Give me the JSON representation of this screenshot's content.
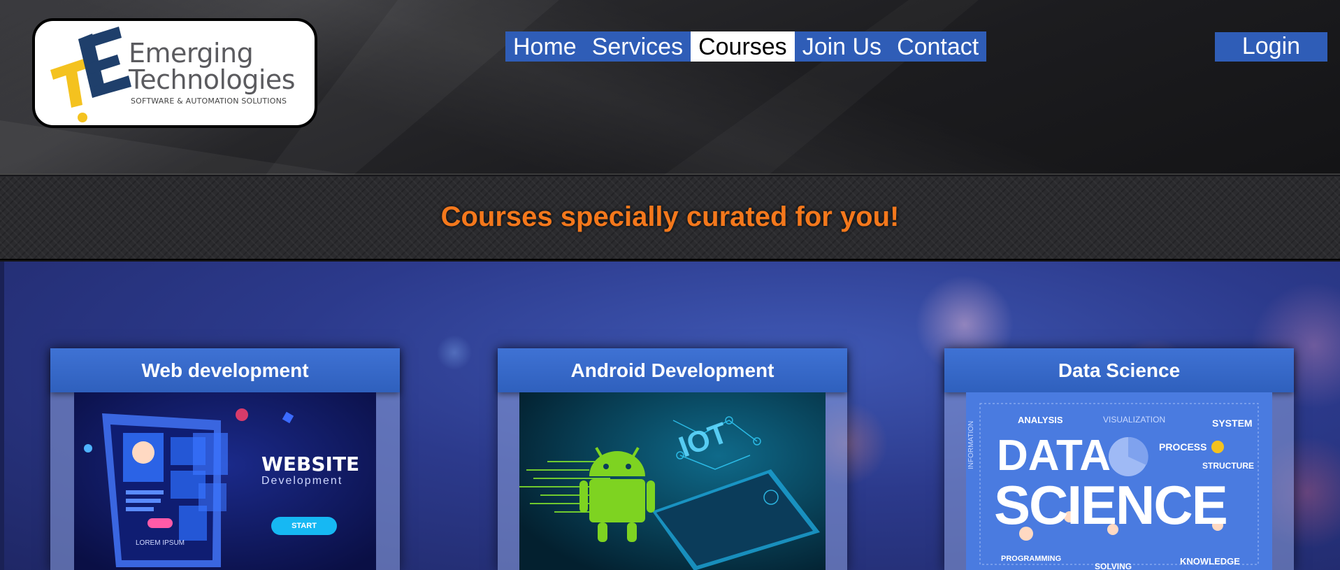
{
  "brand": {
    "name_line1": "Emerging",
    "name_line2": "Technologies",
    "tagline": "SOFTWARE & AUTOMATION SOLUTIONS",
    "logo_colors": {
      "dark": "#1f3f6b",
      "yellow": "#f4c21f"
    }
  },
  "nav": {
    "items": [
      {
        "label": "Home",
        "active": false
      },
      {
        "label": "Services",
        "active": false
      },
      {
        "label": "Courses",
        "active": true
      },
      {
        "label": "Join Us",
        "active": false
      },
      {
        "label": "Contact",
        "active": false
      }
    ],
    "login_label": "Login"
  },
  "band": {
    "title": "Courses specially curated for you!"
  },
  "courses": [
    {
      "title": "Web development",
      "image": {
        "icon": "laptop-illustration",
        "title": "WEBSITE",
        "subtitle": "Development",
        "button": "START",
        "caption": "LOREM IPSUM"
      }
    },
    {
      "title": "Android Development",
      "image": {
        "icon": "android-robot-illustration",
        "label": "IOT"
      }
    },
    {
      "title": "Data Science",
      "image": {
        "icon": "data-science-wordcloud",
        "word1": "DATA",
        "word2": "SCIENCE",
        "tags": [
          "ANALYSIS",
          "VISUALIZATION",
          "SYSTEM",
          "PROCESS",
          "STRUCTURE",
          "KNOWLEDGE",
          "PROGRAMMING",
          "SOLVING",
          "INFORMATION"
        ]
      }
    }
  ],
  "colors": {
    "accent_blue": "#2f5db7",
    "tagline_orange": "#f4781c",
    "android_green": "#7ed321",
    "data_blue": "#4a7be0"
  }
}
